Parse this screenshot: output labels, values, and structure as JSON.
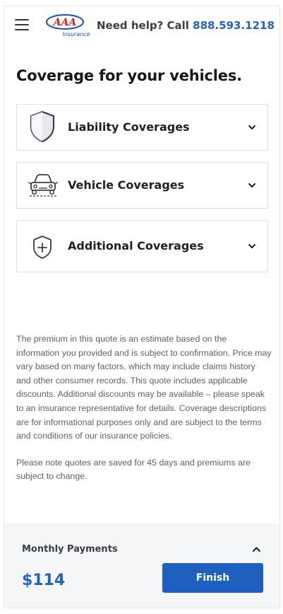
{
  "header": {
    "menu_icon": "hamburger-menu-icon",
    "logo_text": "AAA",
    "logo_subtext": "Insurance",
    "help_prefix": "Need help? Call ",
    "help_phone": "888.593.1218",
    "brand_red": "#d21f2a",
    "brand_blue": "#1f4fa8"
  },
  "page_title": "Coverage for your vehicles.",
  "coverages": [
    {
      "label": "Liability Coverages",
      "icon": "shield-icon"
    },
    {
      "label": "Vehicle Coverages",
      "icon": "car-icon"
    },
    {
      "label": "Additional Coverages",
      "icon": "shield-plus-icon"
    }
  ],
  "disclaimer": {
    "paragraph1": "The premium in this quote is an estimate based on the information you provided and is subject to confirmation. Price may vary based on many factors, which may include claims history and other consumer records. This quote includes applicable discounts. Additional discounts may be available – please speak to an insurance representative for details. Coverage descriptions are for informational purposes only and are subject to the terms and conditions of our insurance policies.",
    "paragraph2": "Please note quotes are saved for 45 days and premiums are subject to change."
  },
  "footer": {
    "label": "Monthly Payments",
    "amount": "$114",
    "finish_label": "Finish",
    "accent": "#1f5fbf"
  }
}
